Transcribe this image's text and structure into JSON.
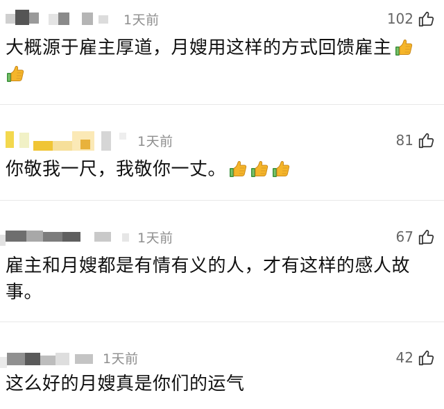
{
  "comments": [
    {
      "time": "1天前",
      "likes": "102",
      "text": "大概源于雇主厚道，月嫂用这样的方式回馈雇主",
      "emoji_count": 2
    },
    {
      "time": "1天前",
      "likes": "81",
      "text": "你敬我一尺，我敬你一丈。",
      "emoji_count": 3
    },
    {
      "time": "1天前",
      "likes": "67",
      "text": "雇主和月嫂都是有情有义的人，才有这样的感人故事。",
      "emoji_count": 0
    },
    {
      "time": "1天前",
      "likes": "42",
      "text": "这么好的月嫂真是你们的运气",
      "emoji_count": 0
    }
  ],
  "icons": {
    "like": "thumbs-up-outline-icon",
    "emoji": "thumbs-up-emoji-icon"
  },
  "colors": {
    "meta_text": "#8e8e8e",
    "count_text": "#666666",
    "body_text": "#111111",
    "divider": "#e8e8e8"
  }
}
